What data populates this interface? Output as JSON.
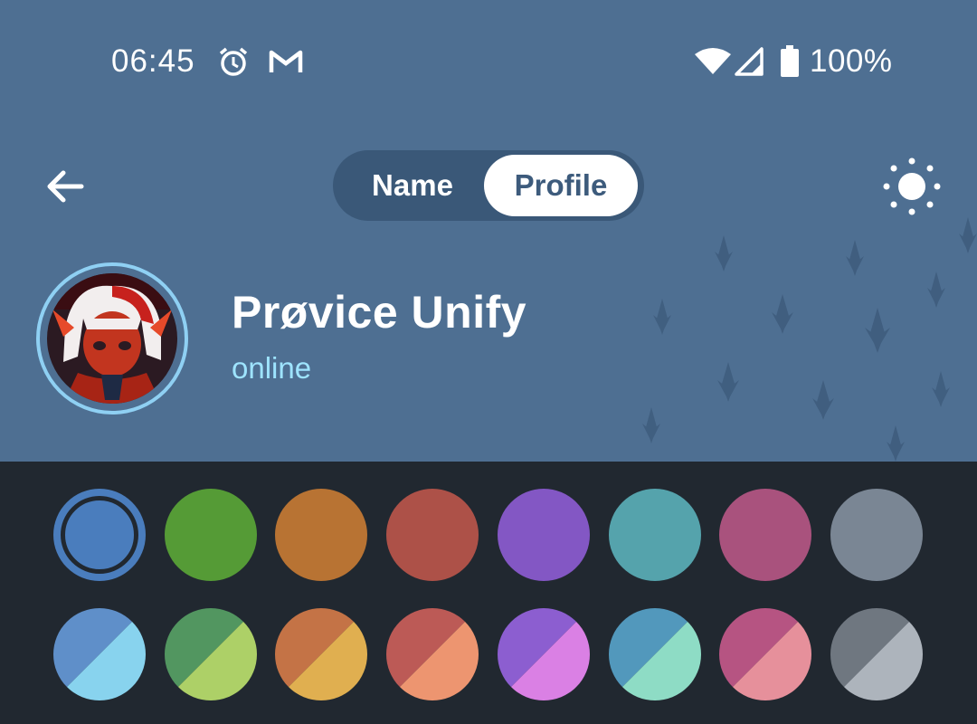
{
  "status_bar": {
    "time": "06:45",
    "battery": "100%",
    "icons": [
      "alarm-icon",
      "gmail-icon",
      "wifi-icon",
      "signal-icon",
      "battery-icon"
    ]
  },
  "toolbar": {
    "back_icon": "back-arrow-icon",
    "tabs": [
      {
        "label": "Name",
        "active": false
      },
      {
        "label": "Profile",
        "active": true
      }
    ],
    "theme_icon": "sun-icon"
  },
  "profile": {
    "name": "Prøvice Unify",
    "status": "online"
  },
  "colors": {
    "header_bg": "#4e6f92",
    "panel_bg": "#212830",
    "status_text": "#9ee4ff",
    "solid_row": [
      "#4a7dbd",
      "#559b36",
      "#b87333",
      "#ad5148",
      "#8357c4",
      "#55a3ac",
      "#a9527d",
      "#7a8694"
    ],
    "dual_row": [
      [
        "#5f8fc9",
        "#88d3ee"
      ],
      [
        "#529660",
        "#add067"
      ],
      [
        "#c47346",
        "#e0af50"
      ],
      [
        "#bc5a56",
        "#ed9570"
      ],
      [
        "#8c5ed0",
        "#da80e4"
      ],
      [
        "#5298bc",
        "#8edcc5"
      ],
      [
        "#b65482",
        "#e6909b"
      ],
      [
        "#6f7780",
        "#adb4bc"
      ]
    ],
    "selected_index": 0
  }
}
